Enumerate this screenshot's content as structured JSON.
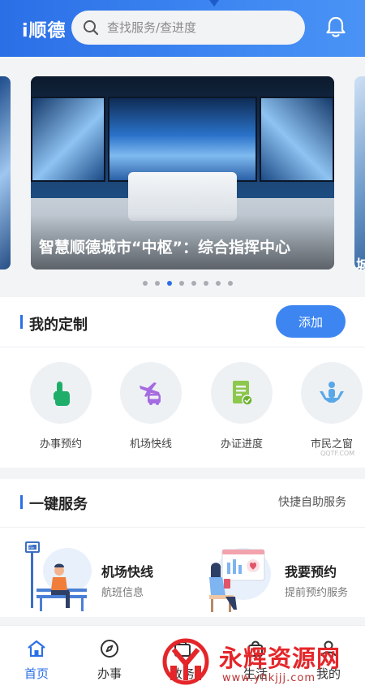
{
  "header": {
    "logo": "i顺德",
    "search_placeholder": "查找服务/查进度"
  },
  "banner": {
    "caption": "智慧顺德城市“中枢”：综合指挥中心",
    "next_caption_peek": "城",
    "total_slides": 8,
    "active_index": 3
  },
  "custom": {
    "title": "我的定制",
    "add_label": "添加",
    "items": [
      {
        "label": "办事预约",
        "icon": "hand-tap-icon",
        "color": "#1fae6a"
      },
      {
        "label": "机场快线",
        "icon": "plane-bus-icon",
        "color": "#a56be0"
      },
      {
        "label": "办证进度",
        "icon": "document-progress-icon",
        "color": "#8cc84b"
      },
      {
        "label": "市民之窗",
        "icon": "citizen-hands-icon",
        "color": "#5aa7e8"
      }
    ]
  },
  "services": {
    "title": "一键服务",
    "link": "快捷自助服务",
    "items": [
      {
        "title": "机场快线",
        "subtitle": "航班信息",
        "illustration": "bus-stop-illustration"
      },
      {
        "title": "我要预约",
        "subtitle": "提前预约服务",
        "illustration": "appointment-illustration"
      }
    ],
    "bus_stop_sign": "BUS STOP"
  },
  "tabbar": {
    "items": [
      {
        "label": "首页",
        "icon": "home-icon",
        "active": true
      },
      {
        "label": "办事",
        "icon": "compass-icon",
        "active": false
      },
      {
        "label": "政务",
        "icon": "briefcase-icon",
        "active": false
      },
      {
        "label": "生活",
        "icon": "bag-icon",
        "active": false
      },
      {
        "label": "我的",
        "icon": "user-icon",
        "active": false
      }
    ]
  },
  "watermark": {
    "text": "永辉资源网",
    "url": "www.yhkjjj.com",
    "small": "QQTF.COM"
  },
  "colors": {
    "primary": "#2b6fe6",
    "button": "#3d86f2",
    "watermark": "#e4262a"
  }
}
